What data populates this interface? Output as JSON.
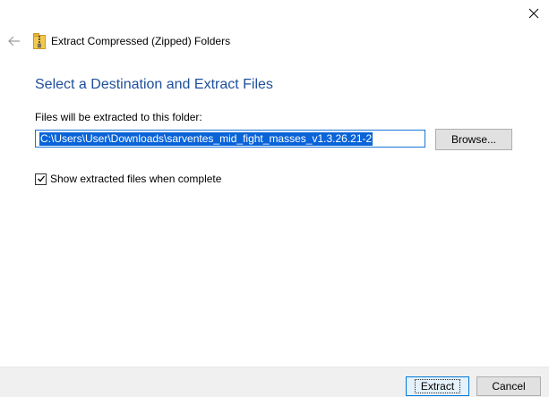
{
  "window": {
    "title": "Extract Compressed (Zipped) Folders",
    "icon": "zip-folder-icon",
    "close_icon": "close-icon",
    "back_icon": "back-arrow-icon"
  },
  "content": {
    "heading": "Select a Destination and Extract Files",
    "folder_label": "Files will be extracted to this folder:",
    "folder_value": "C:\\Users\\User\\Downloads\\sarventes_mid_fight_masses_v1.3.26.21-2",
    "browse_label": "Browse...",
    "show_files_label": "Show extracted files when complete",
    "show_files_checked": true
  },
  "footer": {
    "extract_label": "Extract",
    "cancel_label": "Cancel"
  },
  "colors": {
    "heading": "#1f4e9c",
    "selection": "#0a64d8",
    "accent_border": "#0078d7",
    "footer_bg": "#f0f0f0"
  }
}
